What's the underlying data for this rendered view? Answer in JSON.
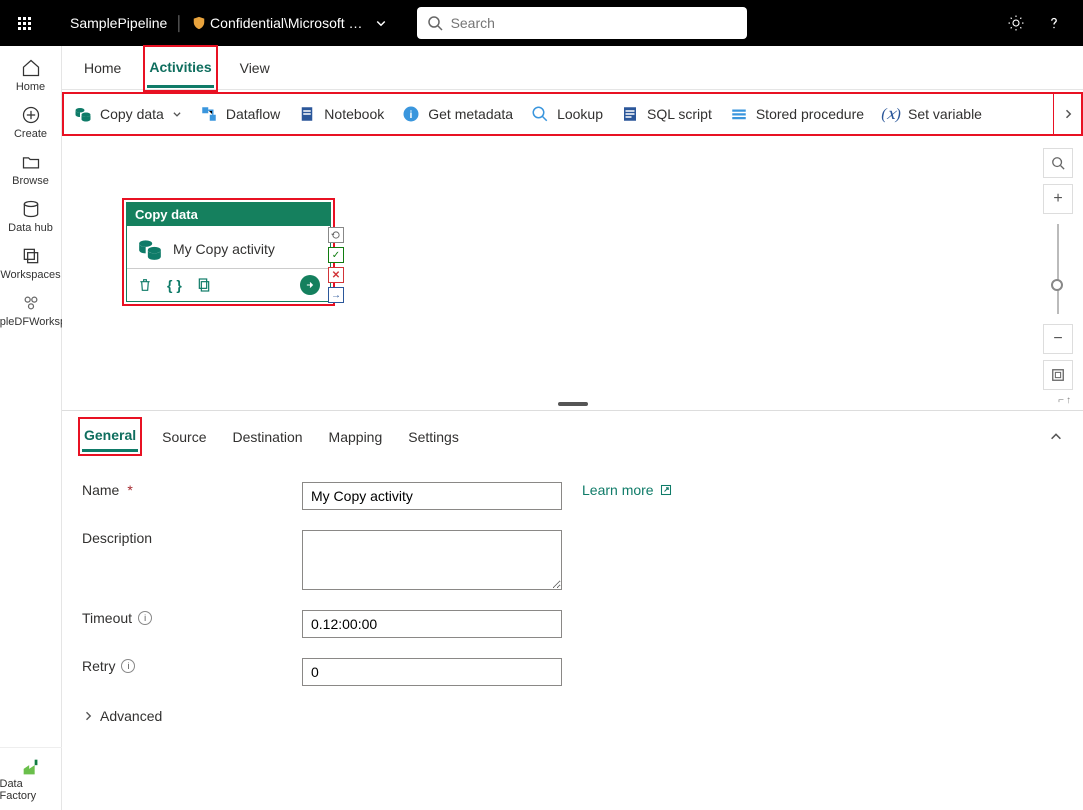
{
  "topbar": {
    "pipeline": "SamplePipeline",
    "workspace": "Confidential\\Microsoft …",
    "search_placeholder": "Search"
  },
  "rail": {
    "items": [
      "Home",
      "Create",
      "Browse",
      "Data hub",
      "Workspaces",
      "SampleDFWorkspace"
    ],
    "bottom": "Data Factory"
  },
  "menu": {
    "items": [
      "Home",
      "Activities",
      "View"
    ],
    "selected": 1
  },
  "ribbon": {
    "items": [
      {
        "label": "Copy data",
        "dropdown": true,
        "icon": "copydata"
      },
      {
        "label": "Dataflow",
        "icon": "dataflow"
      },
      {
        "label": "Notebook",
        "icon": "notebook"
      },
      {
        "label": "Get metadata",
        "icon": "info"
      },
      {
        "label": "Lookup",
        "icon": "search"
      },
      {
        "label": "SQL script",
        "icon": "sql"
      },
      {
        "label": "Stored procedure",
        "icon": "proc"
      },
      {
        "label": "Set variable",
        "icon": "var"
      }
    ]
  },
  "activity_card": {
    "title": "Copy data",
    "name": "My Copy activity"
  },
  "props": {
    "tabs": [
      "General",
      "Source",
      "Destination",
      "Mapping",
      "Settings"
    ],
    "selected": 0,
    "learn_more": "Learn more",
    "fields": {
      "name_label": "Name",
      "name_value": "My Copy activity",
      "desc_label": "Description",
      "desc_value": "",
      "timeout_label": "Timeout",
      "timeout_value": "0.12:00:00",
      "retry_label": "Retry",
      "retry_value": "0",
      "advanced": "Advanced"
    }
  }
}
